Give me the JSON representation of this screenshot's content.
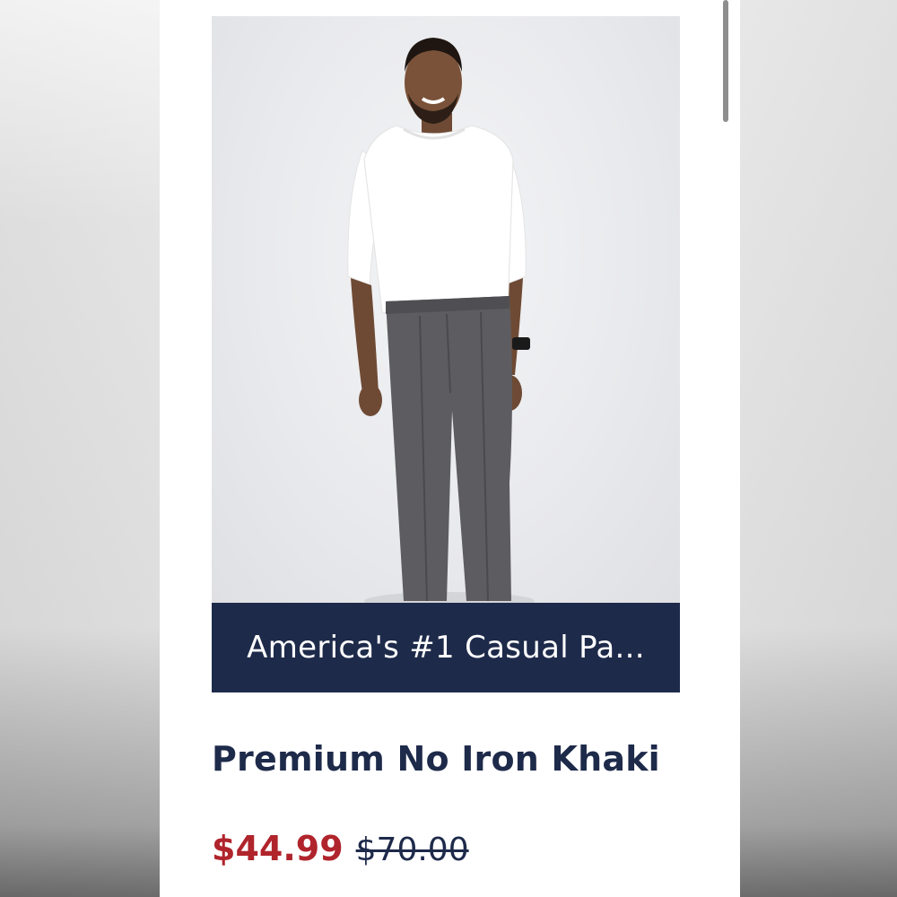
{
  "product": {
    "image": {
      "alt": "Model wearing white long-sleeve tee and gray pleated pants"
    },
    "banner_text": "America's #1 Casual Pa...",
    "title": "Premium No Iron Khaki",
    "sale_price": "$44.99",
    "original_price": "$70.00"
  },
  "colors": {
    "banner_background": "#1e2a4a",
    "title_text": "#1e2a4a",
    "sale_price": "#b0242c",
    "image_background": "#e9eaed"
  }
}
